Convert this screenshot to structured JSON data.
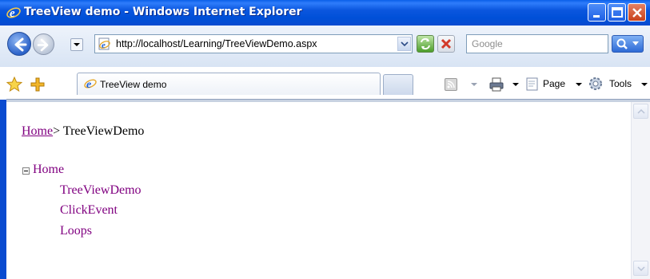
{
  "window": {
    "title": "TreeView demo - Windows Internet Explorer"
  },
  "navbar": {
    "address_url": "http://localhost/Learning/TreeViewDemo.aspx",
    "search_placeholder": "Google"
  },
  "tabs": [
    {
      "label": "TreeView demo",
      "active": true
    }
  ],
  "command_bar": {
    "page_label": "Page",
    "tools_label": "Tools"
  },
  "content": {
    "breadcrumb": {
      "root_link": "Home",
      "separator": ">",
      "current": "TreeViewDemo"
    },
    "tree": {
      "root": {
        "label": "Home",
        "expanded": true
      },
      "children": [
        {
          "label": "TreeViewDemo"
        },
        {
          "label": "ClickEvent"
        },
        {
          "label": "Loops"
        }
      ]
    }
  },
  "colors": {
    "titlebar_blue": "#0050d8",
    "link_visited": "#800080",
    "close_button": "#c8411b"
  }
}
